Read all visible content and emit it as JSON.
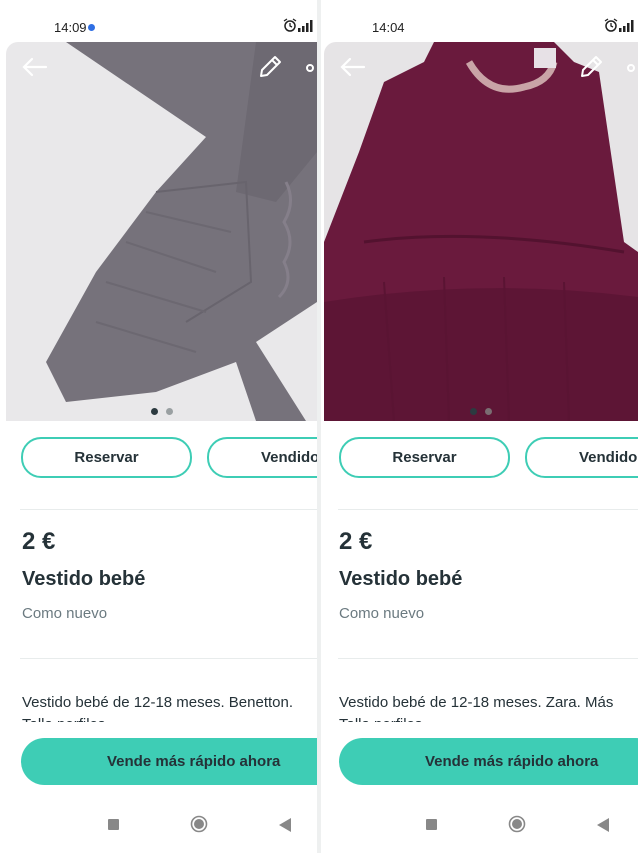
{
  "screens": [
    {
      "status": {
        "time": "14:09"
      },
      "dress_color": "#77737c",
      "actions": {
        "reserve_label": "Reservar",
        "sold_label": "Vendido"
      },
      "product": {
        "price": "2 €",
        "title": "Vestido bebé",
        "condition": "Como nuevo",
        "description": "Vestido bebé de 12-18 meses. Benetton.",
        "description_next_line": "Talla perfiles"
      },
      "cta_label": "Vende más rápido ahora",
      "carousel": {
        "count": 2,
        "active": 1
      }
    },
    {
      "status": {
        "time": "14:04"
      },
      "dress_color": "#6b1b3f",
      "actions": {
        "reserve_label": "Reservar",
        "sold_label": "Vendido"
      },
      "product": {
        "price": "2 €",
        "title": "Vestido bebé",
        "condition": "Como nuevo",
        "description": "Vestido bebé de 12-18 meses. Zara. Más",
        "description_next_line": "Talla perfiles"
      },
      "cta_label": "Vende más rápido ahora",
      "carousel": {
        "count": 2,
        "active": 1
      }
    }
  ],
  "icons": {
    "back": "arrow-left-icon",
    "edit": "pencil-icon",
    "share": "share-icon",
    "alarm": "alarm-icon",
    "signal": "signal-icon",
    "nav_recent": "square-icon",
    "nav_home": "circle-icon",
    "nav_back": "triangle-back-icon"
  },
  "colors": {
    "accent": "#3ecdb5",
    "text": "#253238",
    "muted": "#6b7a80"
  }
}
